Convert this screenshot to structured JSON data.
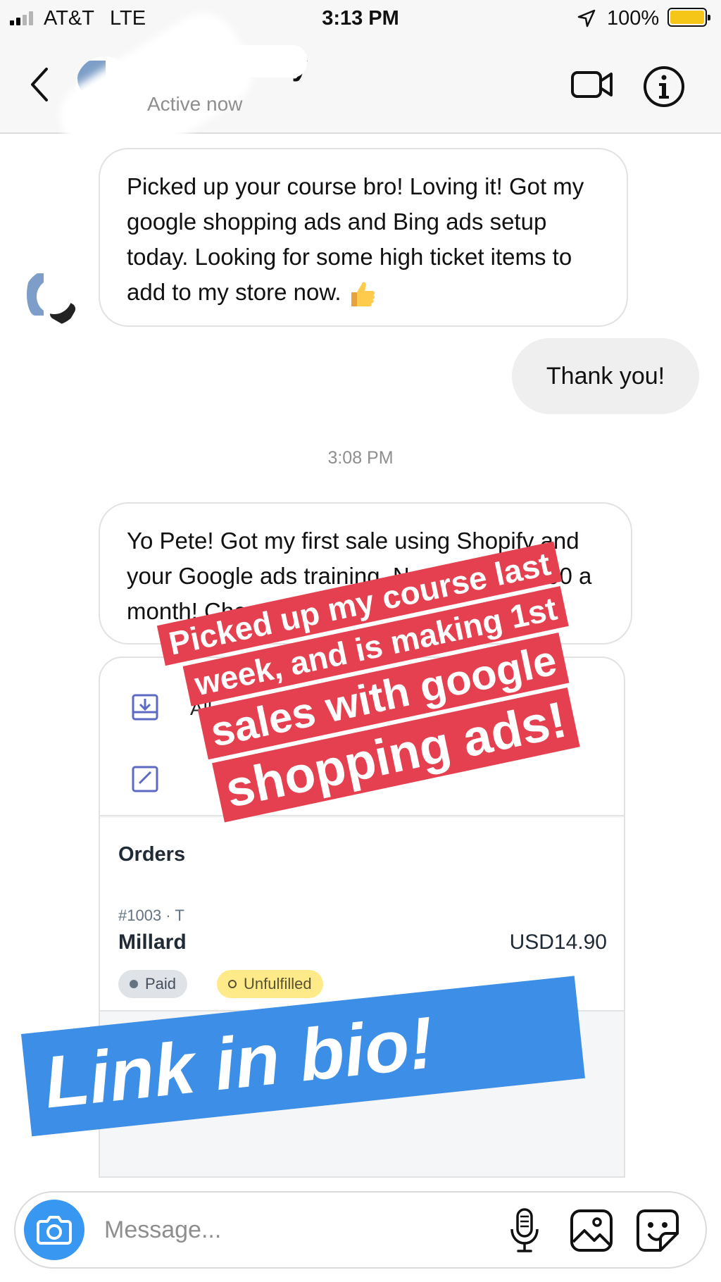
{
  "status_bar": {
    "carrier": "AT&T",
    "network": "LTE",
    "time": "3:13 PM",
    "battery": "100%",
    "battery_level": 1.0,
    "signal_bars": 2
  },
  "header": {
    "contact_name": "airbrushkey",
    "status": "Active now"
  },
  "messages": [
    {
      "from": "contact",
      "text": "Picked up your course bro! Loving it! Got my google shopping ads and Bing ads setup today. Looking for some high ticket items to add to my store now.",
      "emoji": "thumbs-up"
    },
    {
      "from": "me",
      "text": "Thank you!"
    },
    {
      "timestamp": "3:08 PM"
    },
    {
      "from": "contact",
      "text": "Yo Pete! Got my first sale using Shopify and your Google ads training. Next goal is $500 a month! Cheers man"
    }
  ],
  "attachment": {
    "menu_label": "All orders",
    "orders_title": "Orders",
    "order_number": "#1003 · T",
    "customer": "Millard",
    "total": "USD14.90",
    "badges": {
      "paid": "Paid",
      "unfulfilled": "Unfulfilled"
    }
  },
  "overlay": {
    "red_lines": [
      "Picked up my course last",
      "week, and is making 1st",
      "sales with google",
      "shopping ads!"
    ],
    "blue": "Link in bio!"
  },
  "composer": {
    "placeholder": "Message..."
  },
  "colors": {
    "accent_blue": "#3897f0",
    "online_green": "#38c95a",
    "caption_red": "#e5404f",
    "caption_blue": "#3d8ee6",
    "badge_yellow": "#ffea8a"
  },
  "icons": [
    "back-chevron-icon",
    "video-call-icon",
    "info-icon",
    "camera-icon",
    "microphone-icon",
    "gallery-icon",
    "sticker-icon",
    "thumbs-up-icon",
    "download-icon",
    "edit-icon",
    "location-arrow-icon"
  ]
}
